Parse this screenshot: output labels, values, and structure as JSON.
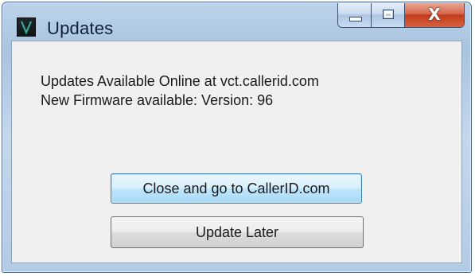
{
  "window": {
    "title": "Updates",
    "icon": "app-logo-icon",
    "close_glyph": "X"
  },
  "message": {
    "line1": "Updates Available Online at vct.callerid.com",
    "line2": "New Firmware available: Version: 96"
  },
  "buttons": {
    "go_label": "Close and go to CallerID.com",
    "later_label": "Update Later"
  },
  "colors": {
    "title_bar": "#a9c4e0",
    "close_button": "#c23b1c",
    "client_background": "#f0f0f0",
    "default_button_border": "#3c7fb1"
  }
}
